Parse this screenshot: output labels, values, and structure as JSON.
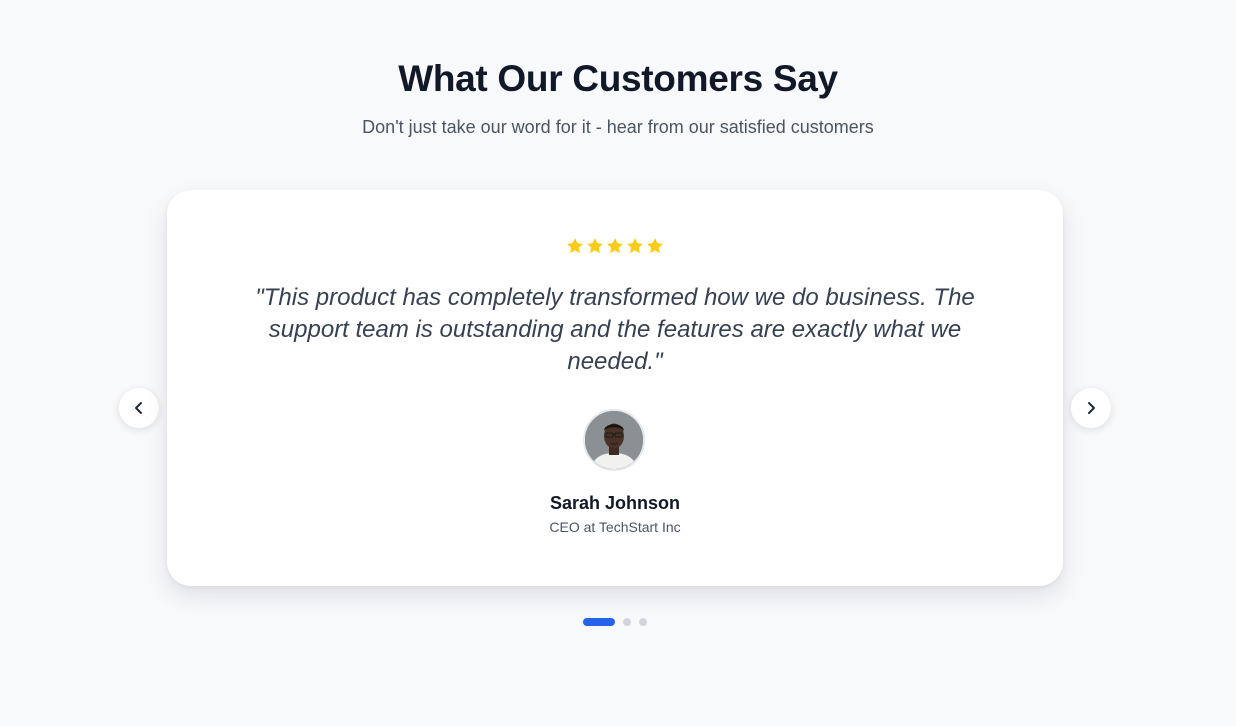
{
  "section": {
    "title": "What Our Customers Say",
    "subtitle": "Don't just take our word for it - hear from our satisfied customers"
  },
  "testimonial": {
    "rating": 5,
    "rating_max": 5,
    "quote": "\"This product has completely transformed how we do business. The support team is outstanding and the features are exactly what we needed.\"",
    "author_name": "Sarah Johnson",
    "author_role": "CEO at TechStart Inc"
  },
  "carousel": {
    "slide_count": 3,
    "active_index": 0
  },
  "icons": {
    "prev": "chevron-left-icon",
    "next": "chevron-right-icon",
    "star": "star-icon"
  },
  "colors": {
    "background": "#f8f9fb",
    "star": "#facc15",
    "active_dot": "#2563eb",
    "inactive_dot": "#d1d5db",
    "heading": "#111827",
    "body_text": "#374151"
  }
}
